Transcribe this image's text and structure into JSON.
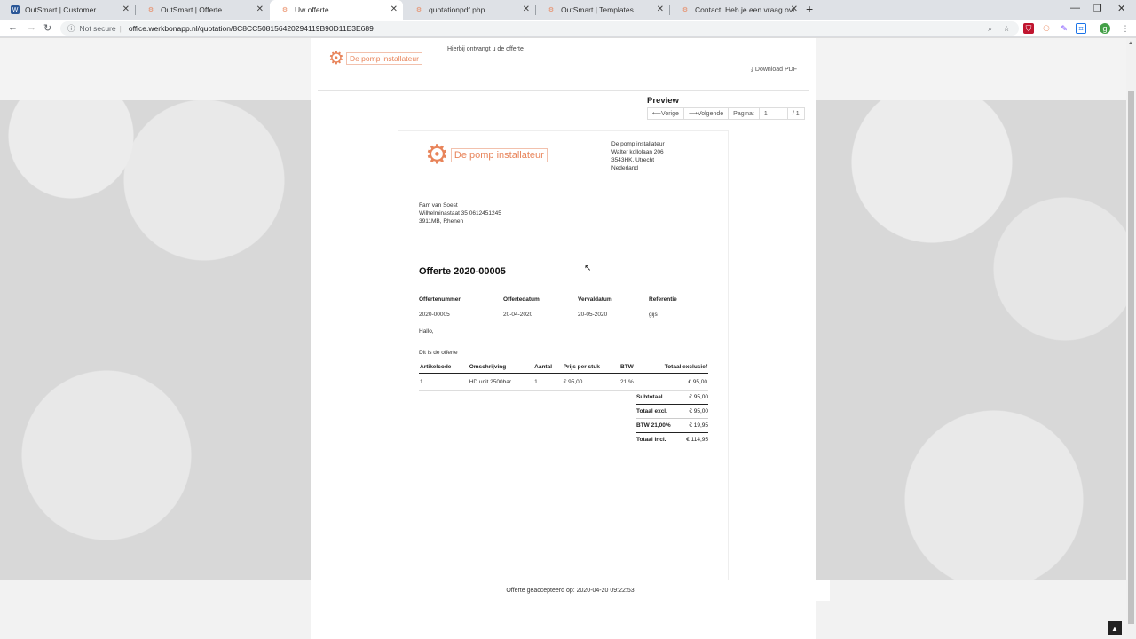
{
  "browser": {
    "tabs": [
      {
        "title": "OutSmart | Customer",
        "favicon_color": "#2b5797",
        "favicon_glyph": "W"
      },
      {
        "title": "OutSmart | Offerte",
        "favicon_color": "#e8845a",
        "favicon_glyph": "⚙"
      },
      {
        "title": "Uw offerte",
        "favicon_color": "#e8845a",
        "favicon_glyph": "⚙"
      },
      {
        "title": "quotationpdf.php",
        "favicon_color": "#e8845a",
        "favicon_glyph": "⚙"
      },
      {
        "title": "OutSmart | Templates",
        "favicon_color": "#e8845a",
        "favicon_glyph": "⚙"
      },
      {
        "title": "Contact: Heb je een vraag over O",
        "favicon_color": "#e8845a",
        "favicon_glyph": "⚙"
      }
    ],
    "security_label": "Not secure",
    "url": "office.werkbonapp.nl/quotation/8C8CC508156420294119B90D11E3E689",
    "profile_initial": "g"
  },
  "header": {
    "company_name": "De pomp installateur",
    "intro_text": "Hierbij ontvangt u de offerte",
    "download_label": "Download PDF"
  },
  "preview": {
    "title": "Preview",
    "prev_label": "Vorige",
    "next_label": "Volgende",
    "page_label": "Pagina:",
    "page_current": "1",
    "page_total": "/ 1"
  },
  "document": {
    "company_name": "De pomp installateur",
    "sender_lines": [
      "De pomp installateur",
      "Walter kollolaan 206",
      "3543HK, Utrecht",
      "Nederland"
    ],
    "recipient_lines": [
      "Fam van Soest",
      "Wilhelminastaat 35 0612451245",
      "3911MB, Rhenen"
    ],
    "title": "Offerte 2020-00005",
    "meta_headers": [
      "Offertenummer",
      "Offertedatum",
      "Vervaldatum",
      "Referentie"
    ],
    "meta_values": [
      "2020-00005",
      "20-04-2020",
      "20-05-2020",
      "gijs"
    ],
    "greeting": "Hallo,",
    "body_text": "Dit is de offerte",
    "table_headers": [
      "Artikelcode",
      "Omschrijving",
      "Aantal",
      "Prijs per stuk",
      "BTW",
      "Totaal exclusief"
    ],
    "rows": [
      [
        "1",
        "HD unit 2500bar",
        "1",
        "€ 95,00",
        "21 %",
        "€ 95,00"
      ]
    ],
    "totals": [
      {
        "label": "Subtotaal",
        "value": "€ 95,00"
      },
      {
        "label": "Totaal excl.",
        "value": "€ 95,00"
      },
      {
        "label": "BTW 21,00%",
        "value": "€ 19,95"
      },
      {
        "label": "Totaal incl.",
        "value": "€ 114,95"
      }
    ]
  },
  "footer": {
    "accepted_text": "Offerte geaccepteerd op: 2020-04-20 09:22:53"
  }
}
